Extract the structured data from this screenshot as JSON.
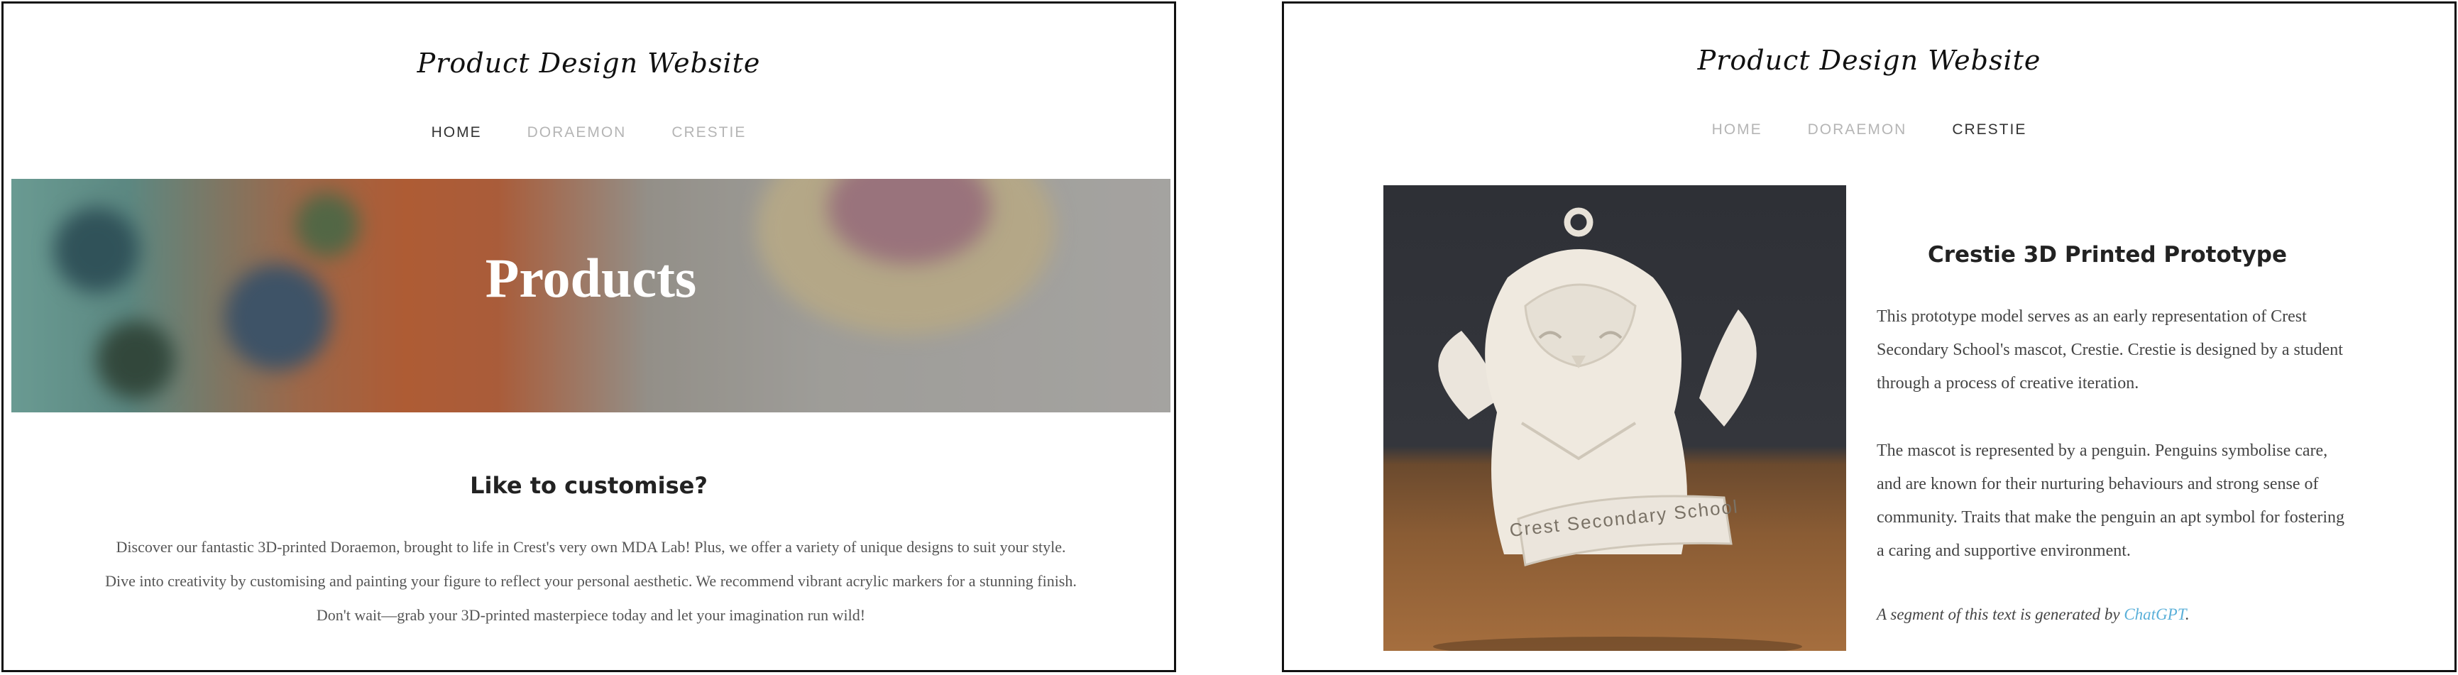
{
  "left_page": {
    "site_title": "Product Design Website",
    "nav": [
      {
        "label": "HOME",
        "active": true
      },
      {
        "label": "DORAEMON",
        "active": false
      },
      {
        "label": "CRESTIE",
        "active": false
      }
    ],
    "hero_title": "Products",
    "section_heading": "Like to customise?",
    "paragraph": "Discover our fantastic 3D-printed Doraemon, brought to life in Crest's very own MDA Lab! Plus, we offer a variety of unique designs to suit your style. Dive into creativity by customising and painting your figure to reflect your personal aesthetic. We recommend vibrant acrylic markers for a stunning finish. Don't wait—grab your 3D-printed masterpiece today and let your imagination run wild!"
  },
  "right_page": {
    "site_title": "Product Design Website",
    "nav": [
      {
        "label": "HOME",
        "active": false
      },
      {
        "label": "DORAEMON",
        "active": false
      },
      {
        "label": "CRESTIE",
        "active": true
      }
    ],
    "image_caption_text": "Crest Secondary School",
    "heading": "Crestie 3D Printed Prototype",
    "paragraph1": "This prototype model serves as an early representation of Crest Secondary School's mascot, Crestie. Crestie is designed by a student through a process of creative iteration.",
    "paragraph2": "The mascot is represented by a penguin. Penguins symbolise care, and are known for their nurturing behaviours and strong sense of community. Traits that make the penguin an apt symbol for fostering a caring and supportive environment.",
    "note_prefix": "A segment of this text is generated by ",
    "note_link": "ChatGPT",
    "note_suffix": "."
  }
}
